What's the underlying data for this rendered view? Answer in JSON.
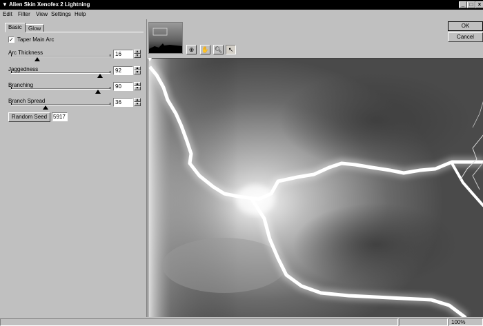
{
  "window": {
    "title": "Alien Skin Xenofex 2 Lightning"
  },
  "menu": [
    "Edit",
    "Filter",
    "View",
    "Settings",
    "Help"
  ],
  "tabs": {
    "basic": "Basic",
    "glow": "Glow"
  },
  "taper": {
    "label": "Taper Main Arc",
    "checked": true
  },
  "sliders": [
    {
      "label": "Arc Thickness",
      "value": "16",
      "fraction": 0.27
    },
    {
      "label": "Jaggedness",
      "value": "92",
      "fraction": 0.92
    },
    {
      "label": "Branching",
      "value": "90",
      "fraction": 0.9
    },
    {
      "label": "Branch Spread",
      "value": "36",
      "fraction": 0.36
    }
  ],
  "seed": {
    "button": "Random Seed",
    "value": "5917"
  },
  "buttons": {
    "ok": "OK",
    "cancel": "Cancel"
  },
  "tools": [
    "preview-zoom-tool-icon",
    "hand-icon",
    "magnifier-icon",
    "arrow-pointer-icon"
  ],
  "status": {
    "zoom": "100%"
  }
}
